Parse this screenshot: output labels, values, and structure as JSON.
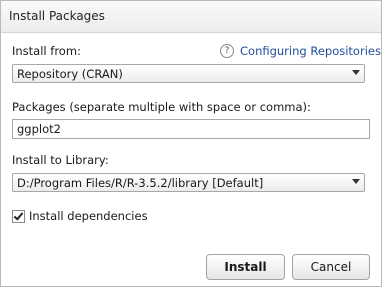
{
  "dialog": {
    "title": "Install Packages"
  },
  "install_from": {
    "label": "Install from:",
    "help_icon": "question-circle-icon",
    "help_link": "Configuring Repositories",
    "selected": "Repository (CRAN)"
  },
  "packages": {
    "label": "Packages (separate multiple with space or comma):",
    "value": "ggplot2"
  },
  "library": {
    "label": "Install to Library:",
    "selected": "D:/Program Files/R/R-3.5.2/library [Default]"
  },
  "dependencies": {
    "label": "Install dependencies",
    "checked": true
  },
  "buttons": {
    "install": "Install",
    "cancel": "Cancel"
  }
}
